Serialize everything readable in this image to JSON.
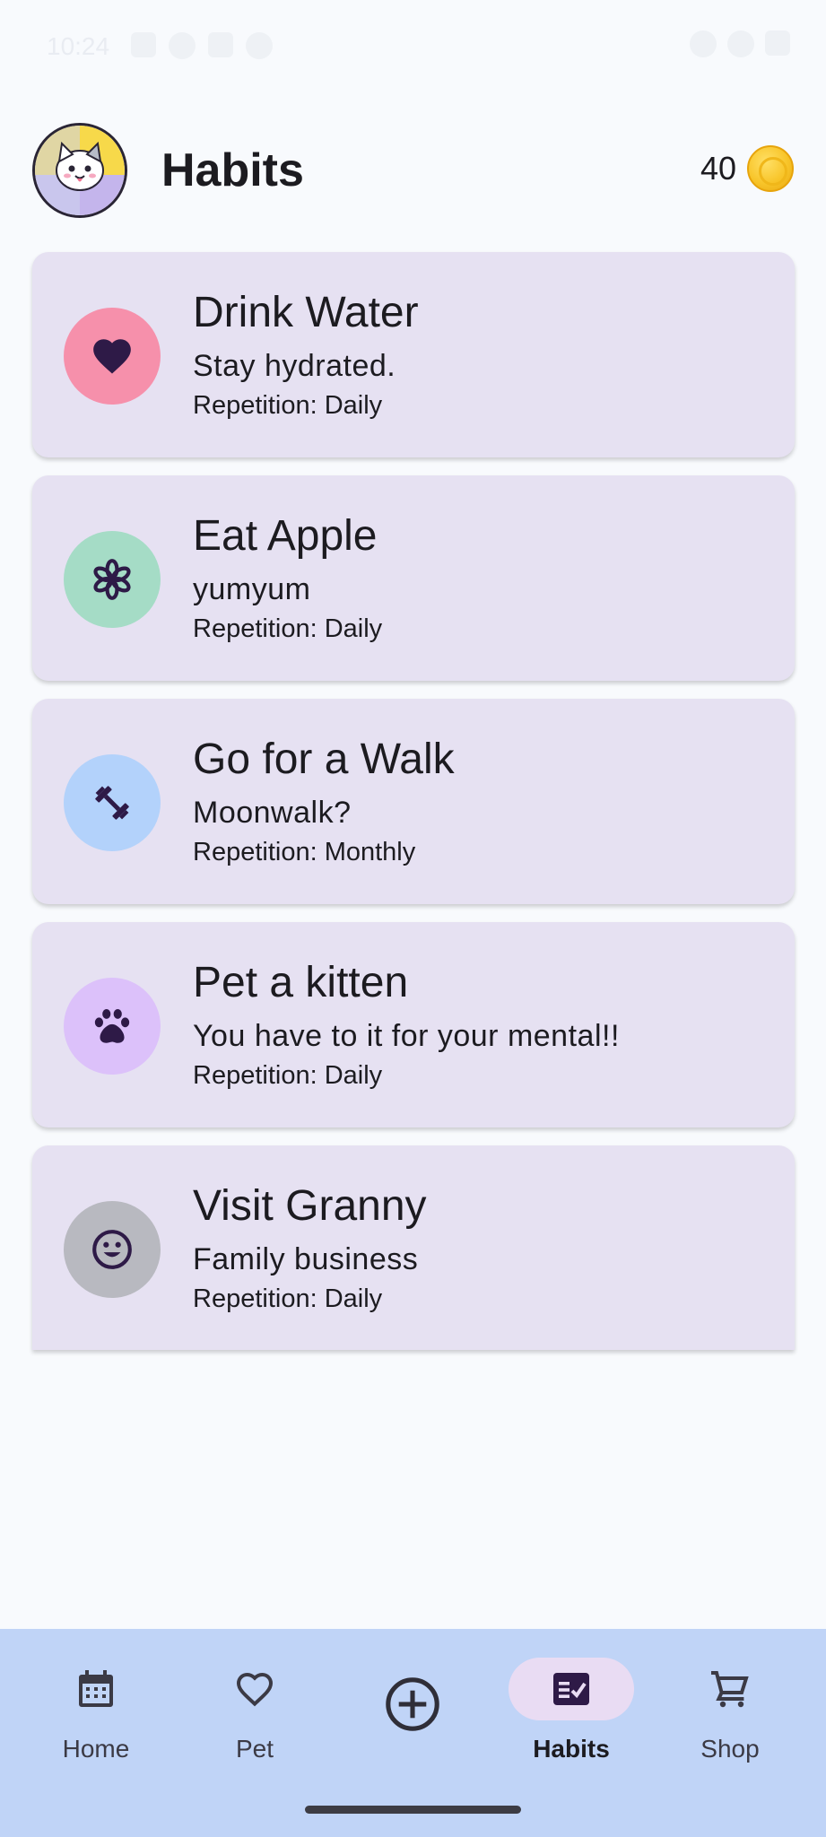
{
  "status_bar": {
    "time": "10:24"
  },
  "header": {
    "title": "Habits",
    "coins": "40"
  },
  "habits": [
    {
      "name": "Drink Water",
      "description": "Stay hydrated.",
      "repetition": "Repetition: Daily",
      "icon": "heart-icon",
      "color": "#f690ab"
    },
    {
      "name": "Eat Apple",
      "description": "yumyum",
      "repetition": "Repetition: Daily",
      "icon": "flower-icon",
      "color": "#a5dcc6"
    },
    {
      "name": "Go for a Walk",
      "description": "Moonwalk?",
      "repetition": "Repetition: Monthly",
      "icon": "dumbbell-icon",
      "color": "#b3d2fb"
    },
    {
      "name": "Pet a kitten",
      "description": "You have to it for your mental!!",
      "repetition": "Repetition: Daily",
      "icon": "paw-icon",
      "color": "#dcc1fa"
    },
    {
      "name": "Visit Granny",
      "description": "Family business",
      "repetition": "Repetition: Daily",
      "icon": "smiley-icon",
      "color": "#b8b9c0"
    }
  ],
  "nav": {
    "items": [
      {
        "label": "Home",
        "icon": "calendar-icon"
      },
      {
        "label": "Pet",
        "icon": "heart-outline-icon"
      },
      {
        "label": "",
        "icon": "add-circle-icon"
      },
      {
        "label": "Habits",
        "icon": "checklist-icon",
        "active": true
      },
      {
        "label": "Shop",
        "icon": "cart-icon"
      }
    ]
  },
  "colors": {
    "background": "#f8fafd",
    "card": "#e6e1f2",
    "nav_bar": "#c0d4f7",
    "nav_active_pill": "#e9dcf3",
    "icon_dark": "#2e1a47"
  }
}
